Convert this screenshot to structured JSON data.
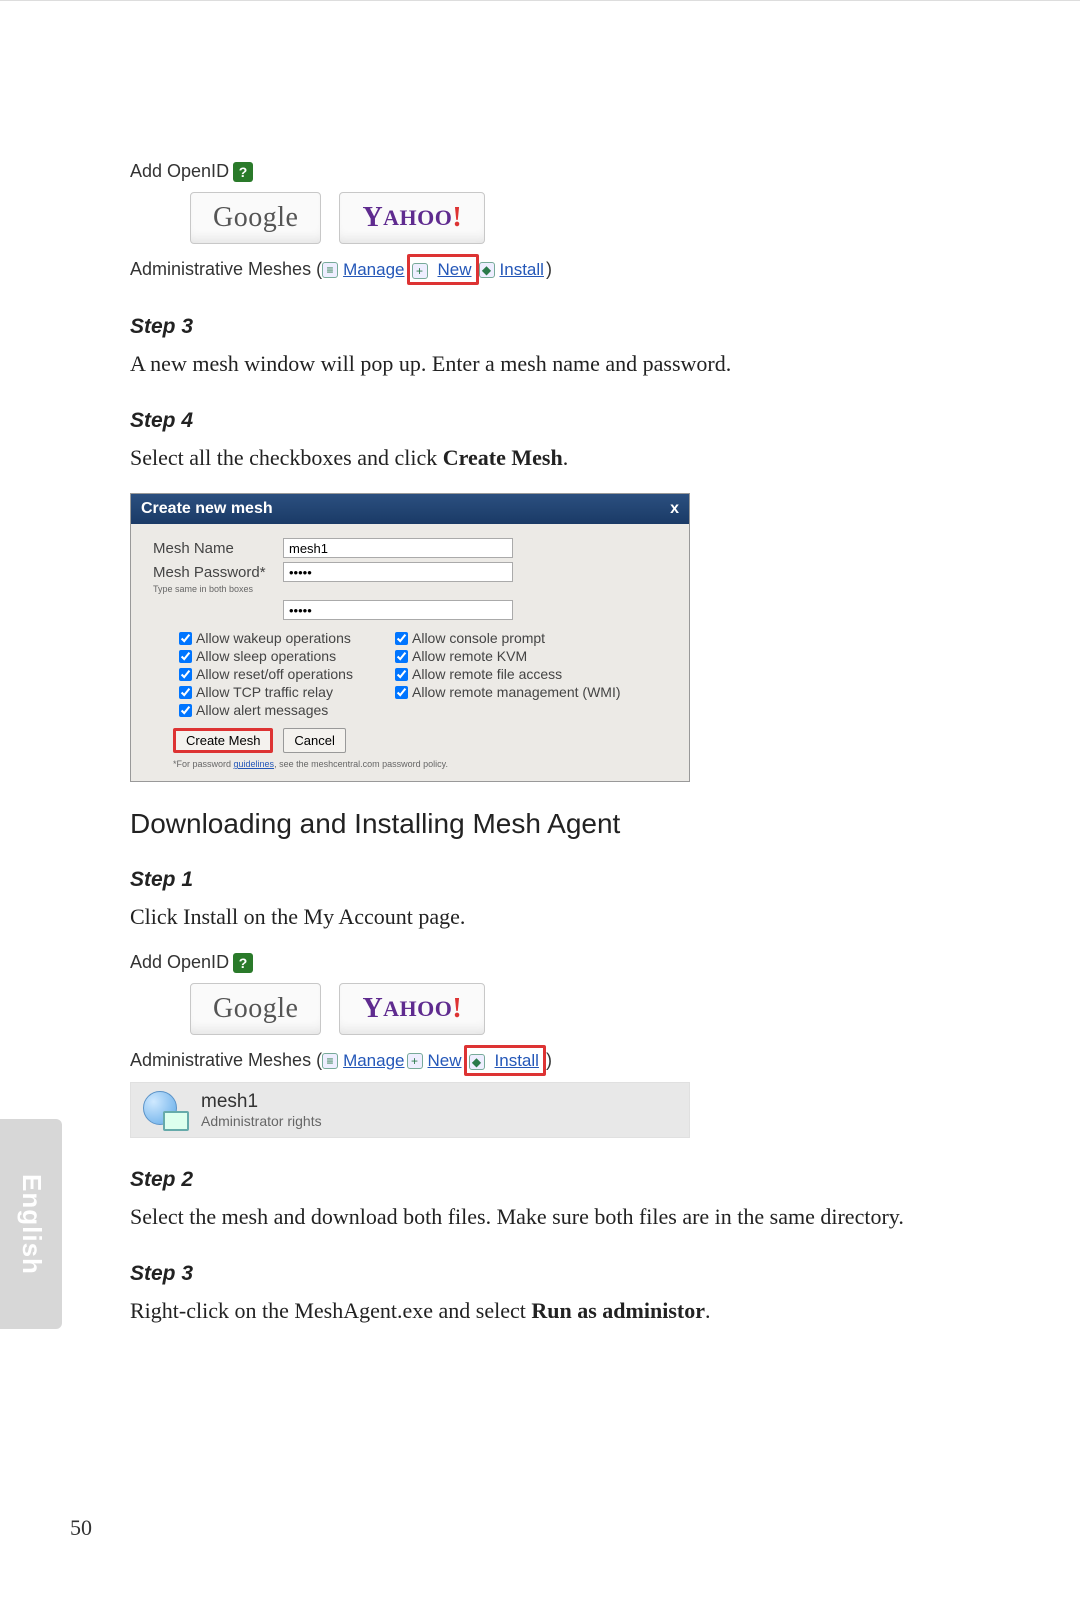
{
  "fig1": {
    "add_openid_label": "Add OpenID",
    "providers": {
      "google": "Google",
      "yahoo_pre": "Y",
      "yahoo_mid": "AHOO",
      "yahoo_bang": "!"
    },
    "admin_label_prefix": "Administrative Meshes ( ",
    "manage": "Manage",
    "new": "New",
    "install": "Install",
    "suffix": " )"
  },
  "step3_label": "Step 3",
  "step3_text": "A new mesh window will pop up. Enter a mesh name and password.",
  "step4_label": "Step 4",
  "step4_text_pre": "Select all the checkboxes and click ",
  "step4_bold": "Create Mesh",
  "step4_text_post": ".",
  "dialog": {
    "title": "Create new mesh",
    "close": "x",
    "mesh_name_label": "Mesh Name",
    "mesh_name_value": "mesh1",
    "mesh_pw_label": "Mesh Password*",
    "mesh_pw_hint": "Type same in both boxes",
    "checks": [
      "Allow wakeup operations",
      "Allow console prompt",
      "Allow sleep operations",
      "Allow remote KVM",
      "Allow reset/off operations",
      "Allow remote file access",
      "Allow TCP traffic relay",
      "Allow remote management (WMI)",
      "Allow alert messages"
    ],
    "create_btn": "Create Mesh",
    "cancel_btn": "Cancel",
    "foot_pre": "*For password ",
    "foot_link": "guidelines",
    "foot_post": ", see the meshcentral.com password policy."
  },
  "section_title": "Downloading and Installing Mesh Agent",
  "b_step1_label": "Step 1",
  "b_step1_text": "Click Install on the My Account page.",
  "fig3": {
    "mesh_name": "mesh1",
    "mesh_role": "Administrator rights"
  },
  "b_step2_label": "Step 2",
  "b_step2_text": "Select the mesh and download both files. Make sure both files are in the same directory.",
  "b_step3_label": "Step 3",
  "b_step3_pre": "Right-click on the MeshAgent.exe and select ",
  "b_step3_bold": "Run as administor",
  "b_step3_post": ".",
  "side_tab": "English",
  "page_number": "50"
}
